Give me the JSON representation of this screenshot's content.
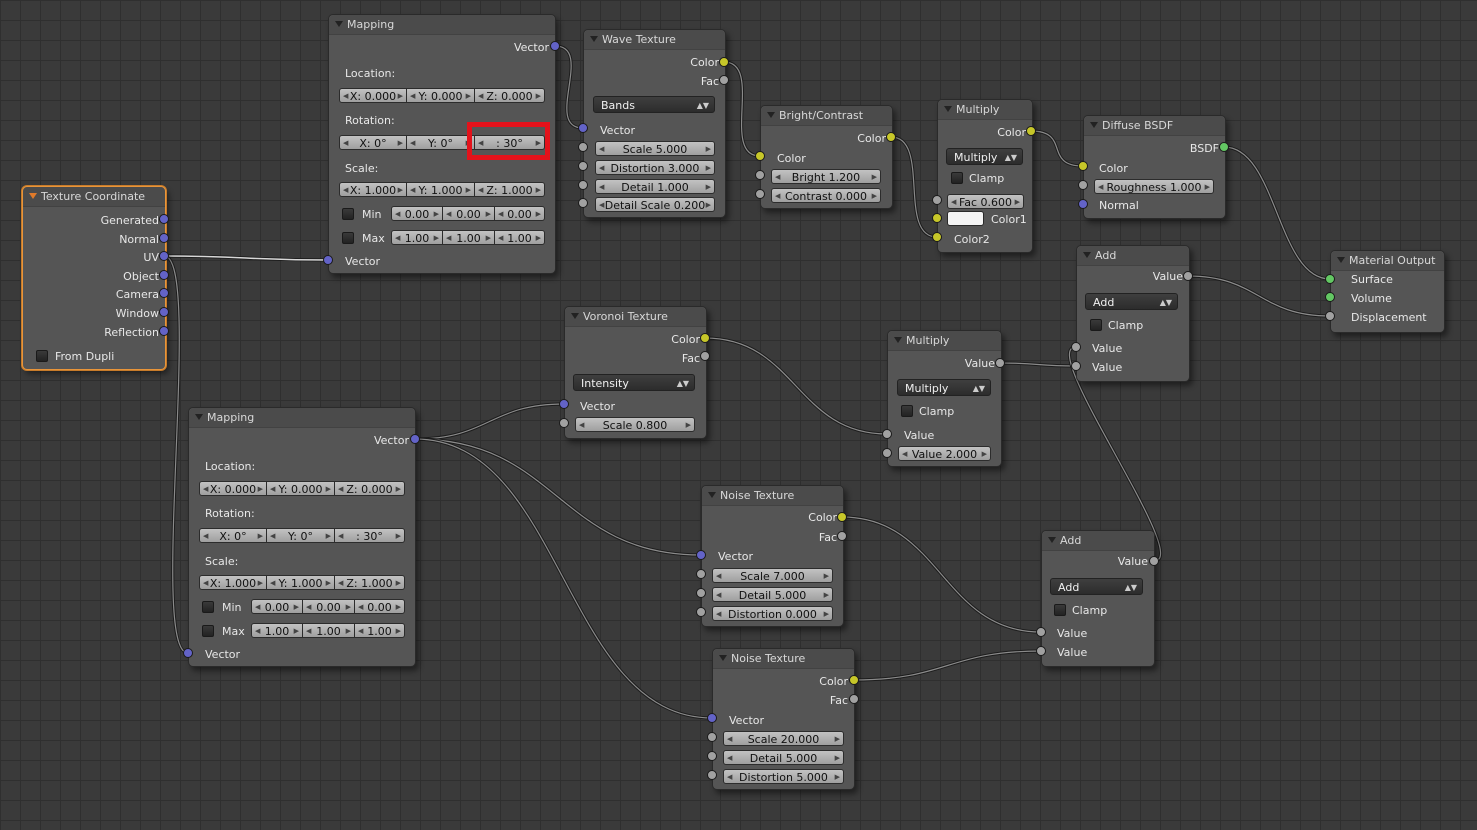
{
  "colors": {
    "background": "#3a3a3a",
    "node_body": "#555555",
    "active_outline": "#e8953a",
    "vector_socket": "#6363c7",
    "color_socket": "#c7c729",
    "float_socket": "#a1a1a1",
    "shader_socket": "#63c763",
    "highlight_box": "#e3121b"
  },
  "tex_coord": {
    "title": "Texture Coordinate",
    "outputs": [
      "Generated",
      "Normal",
      "UV",
      "Object",
      "Camera",
      "Window",
      "Reflection"
    ],
    "from_dupli": "From Dupli"
  },
  "mapping1": {
    "title": "Mapping",
    "output": "Vector",
    "location_label": "Location:",
    "location": [
      "X: 0.000",
      "Y: 0.000",
      "Z: 0.000"
    ],
    "rotation_label": "Rotation:",
    "rotation": [
      "X: 0°",
      "Y: 0°",
      ": 30°"
    ],
    "scale_label": "Scale:",
    "scale": [
      "X: 1.000",
      "Y: 1.000",
      "Z: 1.000"
    ],
    "min_label": "Min",
    "min": [
      "0.00",
      "0.00",
      "0.00"
    ],
    "max_label": "Max",
    "max": [
      "1.00",
      "1.00",
      "1.00"
    ],
    "input": "Vector"
  },
  "mapping2": {
    "title": "Mapping",
    "output": "Vector",
    "location_label": "Location:",
    "location": [
      "X: 0.000",
      "Y: 0.000",
      "Z: 0.000"
    ],
    "rotation_label": "Rotation:",
    "rotation": [
      "X: 0°",
      "Y: 0°",
      ": 30°"
    ],
    "scale_label": "Scale:",
    "scale": [
      "X: 1.000",
      "Y: 1.000",
      "Z: 1.000"
    ],
    "min_label": "Min",
    "min": [
      "0.00",
      "0.00",
      "0.00"
    ],
    "max_label": "Max",
    "max": [
      "1.00",
      "1.00",
      "1.00"
    ],
    "input": "Vector"
  },
  "wave": {
    "title": "Wave Texture",
    "outputs": [
      "Color",
      "Fac"
    ],
    "type": "Bands",
    "vector": "Vector",
    "fields": [
      "Scale 5.000",
      "Distortion 3.000",
      "Detail 1.000",
      "Detail Scale 0.200"
    ]
  },
  "bright": {
    "title": "Bright/Contrast",
    "output": "Color",
    "input": "Color",
    "fields": [
      "Bright 1.200",
      "Contrast 0.000"
    ]
  },
  "multiply1": {
    "title": "Multiply",
    "output": "Color",
    "mode": "Multiply",
    "clamp": "Clamp",
    "fac": "Fac 0.600",
    "color1": "Color1",
    "color2": "Color2"
  },
  "diffuse": {
    "title": "Diffuse BSDF",
    "output": "BSDF",
    "color": "Color",
    "roughness": "Roughness 1.000",
    "normal": "Normal"
  },
  "material_output": {
    "title": "Material Output",
    "inputs": [
      "Surface",
      "Volume",
      "Displacement"
    ]
  },
  "add1": {
    "title": "Add",
    "output": "Value",
    "mode": "Add",
    "clamp": "Clamp",
    "inputs": [
      "Value",
      "Value"
    ]
  },
  "voronoi": {
    "title": "Voronoi Texture",
    "outputs": [
      "Color",
      "Fac"
    ],
    "mode": "Intensity",
    "vector": "Vector",
    "scale": "Scale 0.800"
  },
  "multiply2": {
    "title": "Multiply",
    "output": "Value",
    "mode": "Multiply",
    "clamp": "Clamp",
    "input": "Value",
    "value": "Value 2.000"
  },
  "noise1": {
    "title": "Noise Texture",
    "outputs": [
      "Color",
      "Fac"
    ],
    "vector": "Vector",
    "fields": [
      "Scale 7.000",
      "Detail 5.000",
      "Distortion 0.000"
    ]
  },
  "add2": {
    "title": "Add",
    "output": "Value",
    "mode": "Add",
    "clamp": "Clamp",
    "inputs": [
      "Value",
      "Value"
    ]
  },
  "noise2": {
    "title": "Noise Texture",
    "outputs": [
      "Color",
      "Fac"
    ],
    "vector": "Vector",
    "fields": [
      "Scale 20.000",
      "Detail 5.000",
      "Distortion 5.000"
    ]
  }
}
